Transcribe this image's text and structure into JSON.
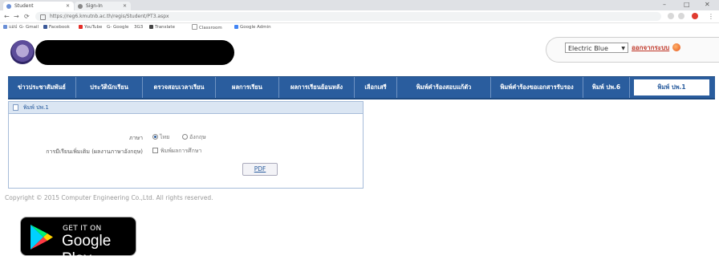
{
  "browser": {
    "tabs": [
      {
        "label": "Student",
        "active": true
      },
      {
        "label": "Sign-In",
        "active": false
      }
    ],
    "url": "https://reg6.kmutnb.ac.th/regis/Student/PT3.aspx",
    "bookmarks": [
      "แอป",
      "G- Gmail",
      "Facebook",
      "YouTube",
      "G- Google",
      "3G3",
      "Translate",
      "Classroom",
      "Google Admin"
    ]
  },
  "header": {
    "theme_value": "Electric Blue",
    "logout_label": "ออกจากระบบ"
  },
  "nav": {
    "items": [
      {
        "label": "ข่าวประชาสัมพันธ์",
        "active": false
      },
      {
        "label": "ประวัตินักเรียน",
        "active": false
      },
      {
        "label": "ตรวจสอบเวลาเรียน",
        "active": false
      },
      {
        "label": "ผลการเรียน",
        "active": false
      },
      {
        "label": "ผลการเรียนย้อนหลัง",
        "active": false
      },
      {
        "label": "เลือกเสรี",
        "active": false
      },
      {
        "label": "พิมพ์คำร้องสอบแก้ตัว",
        "active": false
      },
      {
        "label": "พิมพ์คำร้องขอเอกสารรับรอง",
        "active": false
      },
      {
        "label": "พิมพ์ ปพ.6",
        "active": false
      },
      {
        "label": "พิมพ์ ปพ.1",
        "active": true
      }
    ]
  },
  "panel": {
    "title": "พิมพ์ ปพ.1",
    "language_label": "ภาษา",
    "language_options": [
      {
        "label": "ไทย",
        "checked": true
      },
      {
        "label": "อังกฤษ",
        "checked": false
      }
    ],
    "graduate_label": "การมีเรียนเพิ่มเติม (ผลงานภาษาอังกฤษ)",
    "graduate_checkbox_label": "พิมพ์ผลการศึกษา",
    "pdf_label": "PDF"
  },
  "footer": {
    "copyright": "Copyright © 2015 Computer Engineering Co.,Ltd. All rights reserved."
  },
  "badge": {
    "small_text": "GET IT ON",
    "big_text": "Google Play"
  },
  "colors": {
    "nav_bg": "#2a5d9e",
    "panel_head_bg": "#dbe6f3",
    "logout": "#c0392b"
  }
}
